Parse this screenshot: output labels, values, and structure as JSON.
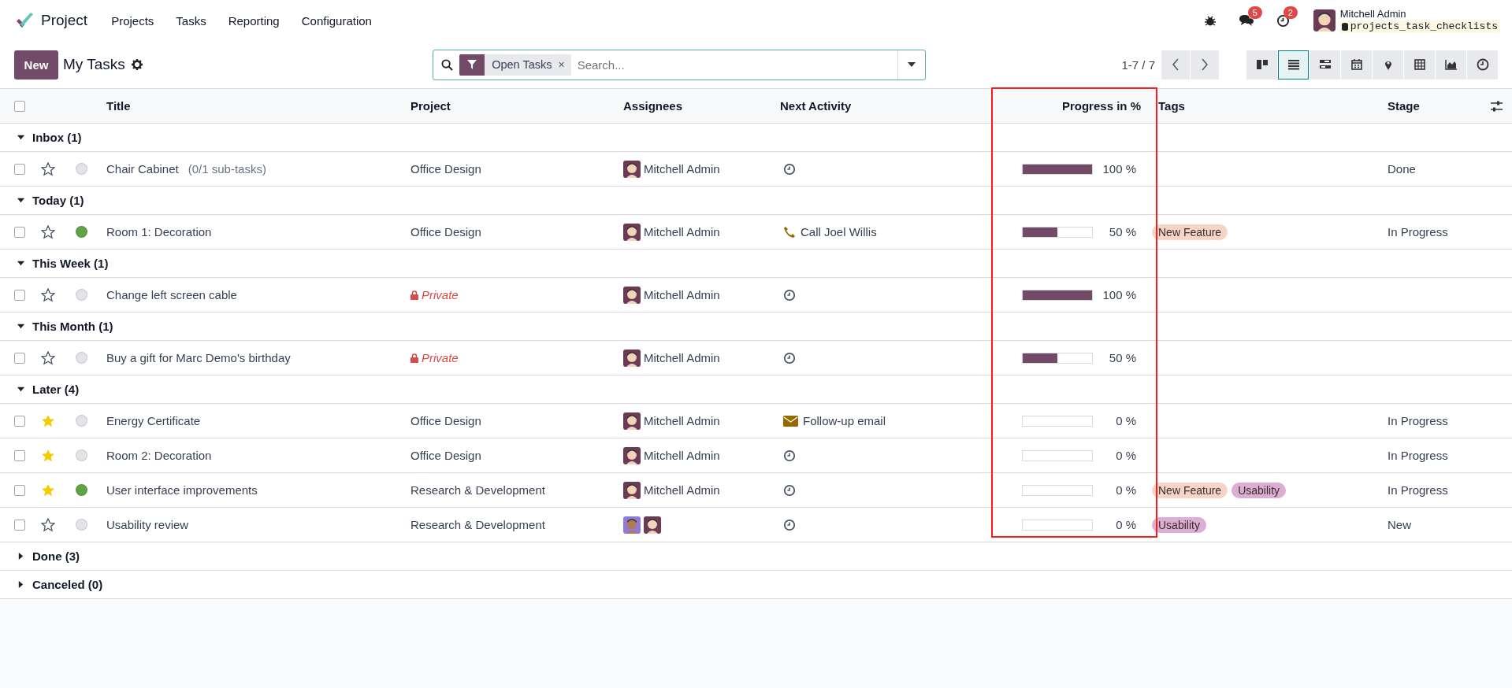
{
  "navbar": {
    "app_name": "Project",
    "menu": [
      "Projects",
      "Tasks",
      "Reporting",
      "Configuration"
    ],
    "messages_badge": "5",
    "activities_badge": "2",
    "user_name": "Mitchell Admin",
    "database": "projects_task_checklists"
  },
  "control_panel": {
    "new_button": "New",
    "title": "My Tasks",
    "facet": {
      "label": "Open Tasks",
      "remove": "×"
    },
    "search": {
      "placeholder": "Search..."
    },
    "pager": "1-7 / 7",
    "views": [
      {
        "kind": "kanban",
        "selected": false
      },
      {
        "kind": "list",
        "selected": true
      },
      {
        "kind": "gantt",
        "selected": false
      },
      {
        "kind": "calendar",
        "selected": false
      },
      {
        "kind": "map",
        "selected": false
      },
      {
        "kind": "pivot",
        "selected": false
      },
      {
        "kind": "graph",
        "selected": false
      },
      {
        "kind": "activity",
        "selected": false
      }
    ]
  },
  "table": {
    "select_all_checked": false,
    "columns": [
      "Title",
      "Project",
      "Assignees",
      "Next Activity",
      "Progress in %",
      "Tags",
      "Stage"
    ],
    "groups": [
      {
        "label": "Inbox (1)",
        "expanded": true,
        "rows": [
          {
            "checked": false,
            "starred": false,
            "color": "#e2e4e8",
            "title": "Chair Cabinet",
            "subtasks": "(0/1 sub-tasks)",
            "project": "Office Design",
            "private": false,
            "assignees": [
              {
                "name": "Mitchell Admin",
                "kind": "admin"
              }
            ],
            "activity": {
              "kind": "clock"
            },
            "level": 1,
            "progress": "100 %",
            "stage": "Done"
          }
        ]
      },
      {
        "label": "Today (1)",
        "expanded": true,
        "rows": [
          {
            "checked": false,
            "starred": false,
            "color": "#5fa344",
            "title": "Room 1: Decoration",
            "project": "Office Design",
            "private": false,
            "assignees": [
              {
                "name": "Mitchell Admin",
                "kind": "admin"
              }
            ],
            "activity": {
              "kind": "phone",
              "label": "Call Joel Willis"
            },
            "level": 0.5,
            "progress": "50 %",
            "tags": [
              {
                "label": "New Feature",
                "color": "#f6d5c7"
              }
            ],
            "stage": "In Progress"
          }
        ]
      },
      {
        "label": "This Week (1)",
        "expanded": true,
        "rows": [
          {
            "checked": false,
            "starred": false,
            "color": "#e2e4e8",
            "title": "Change left screen cable",
            "project": "Private",
            "private": true,
            "assignees": [
              {
                "name": "Mitchell Admin",
                "kind": "admin"
              }
            ],
            "activity": {
              "kind": "clock"
            },
            "level": 1,
            "progress": "100 %"
          }
        ]
      },
      {
        "label": "This Month (1)",
        "expanded": true,
        "rows": [
          {
            "checked": false,
            "starred": false,
            "color": "#e2e4e8",
            "title": "Buy a gift for Marc Demo's birthday",
            "project": "Private",
            "private": true,
            "assignees": [
              {
                "name": "Mitchell Admin",
                "kind": "admin"
              }
            ],
            "activity": {
              "kind": "clock"
            },
            "level": 0.5,
            "progress": "50 %"
          }
        ]
      },
      {
        "label": "Later (4)",
        "expanded": true,
        "rows": [
          {
            "checked": false,
            "starred": true,
            "color": "#e2e4e8",
            "title": "Energy Certificate",
            "project": "Office Design",
            "private": false,
            "assignees": [
              {
                "name": "Mitchell Admin",
                "kind": "admin"
              }
            ],
            "activity": {
              "kind": "email",
              "label": "Follow-up email"
            },
            "level": 0,
            "progress": "0 %",
            "stage": "In Progress"
          },
          {
            "checked": false,
            "starred": true,
            "color": "#e2e4e8",
            "title": "Room 2: Decoration",
            "project": "Office Design",
            "private": false,
            "assignees": [
              {
                "name": "Mitchell Admin",
                "kind": "admin"
              }
            ],
            "activity": {
              "kind": "clock"
            },
            "level": 0,
            "progress": "0 %",
            "stage": "In Progress"
          },
          {
            "checked": false,
            "starred": true,
            "color": "#5fa344",
            "title": "User interface improvements",
            "project": "Research & Development",
            "private": false,
            "assignees": [
              {
                "name": "Mitchell Admin",
                "kind": "admin"
              }
            ],
            "activity": {
              "kind": "clock"
            },
            "level": 0,
            "progress": "0 %",
            "tags": [
              {
                "label": "New Feature",
                "color": "#f6d5c7"
              },
              {
                "label": "Usability",
                "color": "#dcaed3"
              }
            ],
            "stage": "In Progress"
          },
          {
            "checked": false,
            "starred": false,
            "color": "#e2e4e8",
            "title": "Usability review",
            "project": "Research & Development",
            "private": false,
            "assignees": [
              {
                "kind": "demo"
              },
              {
                "kind": "admin"
              }
            ],
            "activity": {
              "kind": "clock"
            },
            "level": 0,
            "progress": "0 %",
            "tags": [
              {
                "label": "Usability",
                "color": "#dcaed3"
              }
            ],
            "stage": "New"
          }
        ]
      },
      {
        "label": "Done (3)",
        "expanded": false
      },
      {
        "label": "Canceled (0)",
        "expanded": false
      }
    ]
  }
}
